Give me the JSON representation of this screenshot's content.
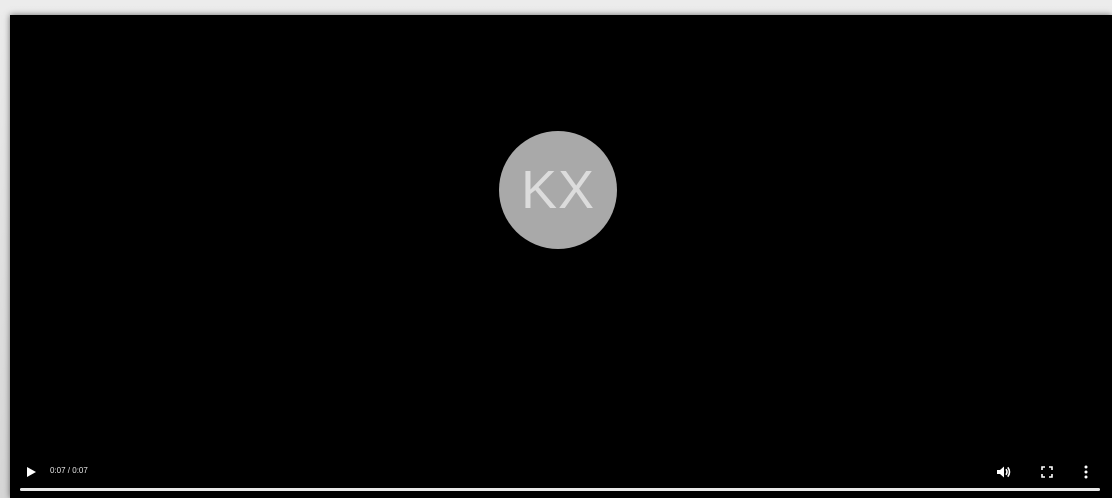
{
  "avatar": {
    "initials": "KX",
    "background_color": "#a9a9a9",
    "text_color": "#dcdcdc"
  },
  "player": {
    "background_color": "#000000",
    "time_display": "0:07 / 0:07",
    "progress_fraction": 1.0,
    "controls": {
      "play": {
        "icon": "play-icon"
      },
      "volume": {
        "icon": "volume-icon"
      },
      "fullscreen": {
        "icon": "fullscreen-icon"
      },
      "more": {
        "icon": "more-vertical-icon"
      }
    }
  }
}
